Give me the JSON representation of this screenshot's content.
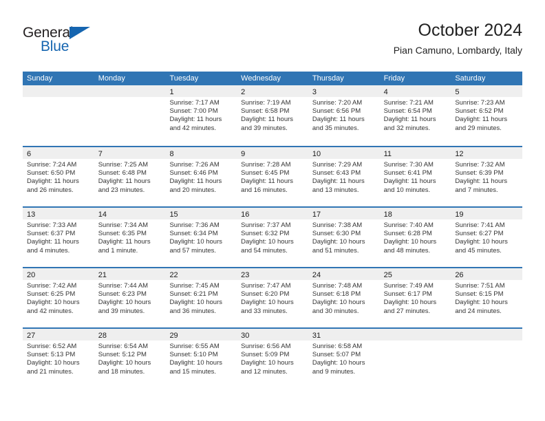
{
  "brand": {
    "name_top": "General",
    "name_bottom": "Blue"
  },
  "header": {
    "title": "October 2024",
    "subtitle": "Pian Camuno, Lombardy, Italy"
  },
  "colors": {
    "header_blue": "#3075b4",
    "logo_blue": "#1565b0",
    "day_strip_gray": "#efefef"
  },
  "calendar": {
    "day_names": [
      "Sunday",
      "Monday",
      "Tuesday",
      "Wednesday",
      "Thursday",
      "Friday",
      "Saturday"
    ],
    "weeks": [
      [
        {
          "day": "",
          "lines": []
        },
        {
          "day": "",
          "lines": []
        },
        {
          "day": "1",
          "lines": [
            "Sunrise: 7:17 AM",
            "Sunset: 7:00 PM",
            "Daylight: 11 hours",
            "and 42 minutes."
          ]
        },
        {
          "day": "2",
          "lines": [
            "Sunrise: 7:19 AM",
            "Sunset: 6:58 PM",
            "Daylight: 11 hours",
            "and 39 minutes."
          ]
        },
        {
          "day": "3",
          "lines": [
            "Sunrise: 7:20 AM",
            "Sunset: 6:56 PM",
            "Daylight: 11 hours",
            "and 35 minutes."
          ]
        },
        {
          "day": "4",
          "lines": [
            "Sunrise: 7:21 AM",
            "Sunset: 6:54 PM",
            "Daylight: 11 hours",
            "and 32 minutes."
          ]
        },
        {
          "day": "5",
          "lines": [
            "Sunrise: 7:23 AM",
            "Sunset: 6:52 PM",
            "Daylight: 11 hours",
            "and 29 minutes."
          ]
        }
      ],
      [
        {
          "day": "6",
          "lines": [
            "Sunrise: 7:24 AM",
            "Sunset: 6:50 PM",
            "Daylight: 11 hours",
            "and 26 minutes."
          ]
        },
        {
          "day": "7",
          "lines": [
            "Sunrise: 7:25 AM",
            "Sunset: 6:48 PM",
            "Daylight: 11 hours",
            "and 23 minutes."
          ]
        },
        {
          "day": "8",
          "lines": [
            "Sunrise: 7:26 AM",
            "Sunset: 6:46 PM",
            "Daylight: 11 hours",
            "and 20 minutes."
          ]
        },
        {
          "day": "9",
          "lines": [
            "Sunrise: 7:28 AM",
            "Sunset: 6:45 PM",
            "Daylight: 11 hours",
            "and 16 minutes."
          ]
        },
        {
          "day": "10",
          "lines": [
            "Sunrise: 7:29 AM",
            "Sunset: 6:43 PM",
            "Daylight: 11 hours",
            "and 13 minutes."
          ]
        },
        {
          "day": "11",
          "lines": [
            "Sunrise: 7:30 AM",
            "Sunset: 6:41 PM",
            "Daylight: 11 hours",
            "and 10 minutes."
          ]
        },
        {
          "day": "12",
          "lines": [
            "Sunrise: 7:32 AM",
            "Sunset: 6:39 PM",
            "Daylight: 11 hours",
            "and 7 minutes."
          ]
        }
      ],
      [
        {
          "day": "13",
          "lines": [
            "Sunrise: 7:33 AM",
            "Sunset: 6:37 PM",
            "Daylight: 11 hours",
            "and 4 minutes."
          ]
        },
        {
          "day": "14",
          "lines": [
            "Sunrise: 7:34 AM",
            "Sunset: 6:35 PM",
            "Daylight: 11 hours",
            "and 1 minute."
          ]
        },
        {
          "day": "15",
          "lines": [
            "Sunrise: 7:36 AM",
            "Sunset: 6:34 PM",
            "Daylight: 10 hours",
            "and 57 minutes."
          ]
        },
        {
          "day": "16",
          "lines": [
            "Sunrise: 7:37 AM",
            "Sunset: 6:32 PM",
            "Daylight: 10 hours",
            "and 54 minutes."
          ]
        },
        {
          "day": "17",
          "lines": [
            "Sunrise: 7:38 AM",
            "Sunset: 6:30 PM",
            "Daylight: 10 hours",
            "and 51 minutes."
          ]
        },
        {
          "day": "18",
          "lines": [
            "Sunrise: 7:40 AM",
            "Sunset: 6:28 PM",
            "Daylight: 10 hours",
            "and 48 minutes."
          ]
        },
        {
          "day": "19",
          "lines": [
            "Sunrise: 7:41 AM",
            "Sunset: 6:27 PM",
            "Daylight: 10 hours",
            "and 45 minutes."
          ]
        }
      ],
      [
        {
          "day": "20",
          "lines": [
            "Sunrise: 7:42 AM",
            "Sunset: 6:25 PM",
            "Daylight: 10 hours",
            "and 42 minutes."
          ]
        },
        {
          "day": "21",
          "lines": [
            "Sunrise: 7:44 AM",
            "Sunset: 6:23 PM",
            "Daylight: 10 hours",
            "and 39 minutes."
          ]
        },
        {
          "day": "22",
          "lines": [
            "Sunrise: 7:45 AM",
            "Sunset: 6:21 PM",
            "Daylight: 10 hours",
            "and 36 minutes."
          ]
        },
        {
          "day": "23",
          "lines": [
            "Sunrise: 7:47 AM",
            "Sunset: 6:20 PM",
            "Daylight: 10 hours",
            "and 33 minutes."
          ]
        },
        {
          "day": "24",
          "lines": [
            "Sunrise: 7:48 AM",
            "Sunset: 6:18 PM",
            "Daylight: 10 hours",
            "and 30 minutes."
          ]
        },
        {
          "day": "25",
          "lines": [
            "Sunrise: 7:49 AM",
            "Sunset: 6:17 PM",
            "Daylight: 10 hours",
            "and 27 minutes."
          ]
        },
        {
          "day": "26",
          "lines": [
            "Sunrise: 7:51 AM",
            "Sunset: 6:15 PM",
            "Daylight: 10 hours",
            "and 24 minutes."
          ]
        }
      ],
      [
        {
          "day": "27",
          "lines": [
            "Sunrise: 6:52 AM",
            "Sunset: 5:13 PM",
            "Daylight: 10 hours",
            "and 21 minutes."
          ]
        },
        {
          "day": "28",
          "lines": [
            "Sunrise: 6:54 AM",
            "Sunset: 5:12 PM",
            "Daylight: 10 hours",
            "and 18 minutes."
          ]
        },
        {
          "day": "29",
          "lines": [
            "Sunrise: 6:55 AM",
            "Sunset: 5:10 PM",
            "Daylight: 10 hours",
            "and 15 minutes."
          ]
        },
        {
          "day": "30",
          "lines": [
            "Sunrise: 6:56 AM",
            "Sunset: 5:09 PM",
            "Daylight: 10 hours",
            "and 12 minutes."
          ]
        },
        {
          "day": "31",
          "lines": [
            "Sunrise: 6:58 AM",
            "Sunset: 5:07 PM",
            "Daylight: 10 hours",
            "and 9 minutes."
          ]
        },
        {
          "day": "",
          "lines": []
        },
        {
          "day": "",
          "lines": []
        }
      ]
    ]
  }
}
